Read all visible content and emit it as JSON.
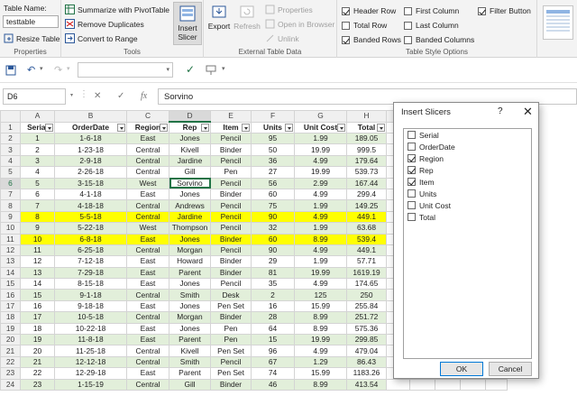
{
  "ribbon": {
    "properties": {
      "table_name_label": "Table Name:",
      "table_name_value": "testtable",
      "resize_label": "Resize Table",
      "group_label": "Properties"
    },
    "tools": {
      "pivot_label": "Summarize with PivotTable",
      "remove_dup_label": "Remove Duplicates",
      "convert_label": "Convert to Range",
      "slicer_label_1": "Insert",
      "slicer_label_2": "Slicer",
      "group_label": "Tools"
    },
    "external": {
      "export_label": "Export",
      "refresh_label": "Refresh",
      "properties_label": "Properties",
      "open_browser_label": "Open in Browser",
      "unlink_label": "Unlink",
      "group_label": "External Table Data"
    },
    "style_options": {
      "header_row": "Header Row",
      "total_row": "Total Row",
      "banded_rows": "Banded Rows",
      "first_column": "First Column",
      "last_column": "Last Column",
      "banded_columns": "Banded Columns",
      "filter_button": "Filter Button",
      "group_label": "Table Style Options"
    }
  },
  "formula_bar": {
    "name_box": "D6",
    "fx": "fx",
    "value": "Sorvino"
  },
  "sheet": {
    "columns": [
      "A",
      "B",
      "C",
      "D",
      "E",
      "F",
      "G",
      "H",
      "I",
      "J",
      "K",
      "L",
      "M"
    ],
    "headers": [
      "Serial",
      "OrderDate",
      "Region",
      "Rep",
      "Item",
      "Units",
      "Unit Cost",
      "Total"
    ],
    "rows": [
      [
        "1",
        "1-6-18",
        "East",
        "Jones",
        "Pencil",
        "95",
        "1.99",
        "189.05"
      ],
      [
        "2",
        "1-23-18",
        "Central",
        "Kivell",
        "Binder",
        "50",
        "19.99",
        "999.5"
      ],
      [
        "3",
        "2-9-18",
        "Central",
        "Jardine",
        "Pencil",
        "36",
        "4.99",
        "179.64"
      ],
      [
        "4",
        "2-26-18",
        "Central",
        "Gill",
        "Pen",
        "27",
        "19.99",
        "539.73"
      ],
      [
        "5",
        "3-15-18",
        "West",
        "Sorvino",
        "Pencil",
        "56",
        "2.99",
        "167.44"
      ],
      [
        "6",
        "4-1-18",
        "East",
        "Jones",
        "Binder",
        "60",
        "4.99",
        "299.4"
      ],
      [
        "7",
        "4-18-18",
        "Central",
        "Andrews",
        "Pencil",
        "75",
        "1.99",
        "149.25"
      ],
      [
        "8",
        "5-5-18",
        "Central",
        "Jardine",
        "Pencil",
        "90",
        "4.99",
        "449.1"
      ],
      [
        "9",
        "5-22-18",
        "West",
        "Thompson",
        "Pencil",
        "32",
        "1.99",
        "63.68"
      ],
      [
        "10",
        "6-8-18",
        "East",
        "Jones",
        "Binder",
        "60",
        "8.99",
        "539.4"
      ],
      [
        "11",
        "6-25-18",
        "Central",
        "Morgan",
        "Pencil",
        "90",
        "4.99",
        "449.1"
      ],
      [
        "12",
        "7-12-18",
        "East",
        "Howard",
        "Binder",
        "29",
        "1.99",
        "57.71"
      ],
      [
        "13",
        "7-29-18",
        "East",
        "Parent",
        "Binder",
        "81",
        "19.99",
        "1619.19"
      ],
      [
        "14",
        "8-15-18",
        "East",
        "Jones",
        "Pencil",
        "35",
        "4.99",
        "174.65"
      ],
      [
        "15",
        "9-1-18",
        "Central",
        "Smith",
        "Desk",
        "2",
        "125",
        "250"
      ],
      [
        "16",
        "9-18-18",
        "East",
        "Jones",
        "Pen Set",
        "16",
        "15.99",
        "255.84"
      ],
      [
        "17",
        "10-5-18",
        "Central",
        "Morgan",
        "Binder",
        "28",
        "8.99",
        "251.72"
      ],
      [
        "18",
        "10-22-18",
        "East",
        "Jones",
        "Pen",
        "64",
        "8.99",
        "575.36"
      ],
      [
        "19",
        "11-8-18",
        "East",
        "Parent",
        "Pen",
        "15",
        "19.99",
        "299.85"
      ],
      [
        "20",
        "11-25-18",
        "Central",
        "Kivell",
        "Pen Set",
        "96",
        "4.99",
        "479.04"
      ],
      [
        "21",
        "12-12-18",
        "Central",
        "Smith",
        "Pencil",
        "67",
        "1.29",
        "86.43"
      ],
      [
        "22",
        "12-29-18",
        "East",
        "Parent",
        "Pen Set",
        "74",
        "15.99",
        "1183.26"
      ],
      [
        "23",
        "1-15-19",
        "Central",
        "Gill",
        "Binder",
        "46",
        "8.99",
        "413.54"
      ]
    ],
    "row_numbers": [
      "1",
      "2",
      "3",
      "4",
      "5",
      "6",
      "7",
      "8",
      "9",
      "10",
      "11",
      "12",
      "13",
      "14",
      "15",
      "16",
      "17",
      "18",
      "19",
      "20",
      "21",
      "22",
      "23",
      "24"
    ],
    "highlight_color": "#ffff00",
    "band_color": "#e2efda",
    "accent": "#217346"
  },
  "dialog": {
    "title": "Insert Slicers",
    "help": "?",
    "close": "✕",
    "fields": [
      {
        "label": "Serial",
        "checked": false
      },
      {
        "label": "OrderDate",
        "checked": false
      },
      {
        "label": "Region",
        "checked": true
      },
      {
        "label": "Rep",
        "checked": true
      },
      {
        "label": "Item",
        "checked": true
      },
      {
        "label": "Units",
        "checked": false
      },
      {
        "label": "Unit Cost",
        "checked": false
      },
      {
        "label": "Total",
        "checked": false
      }
    ],
    "ok": "OK",
    "cancel": "Cancel"
  }
}
